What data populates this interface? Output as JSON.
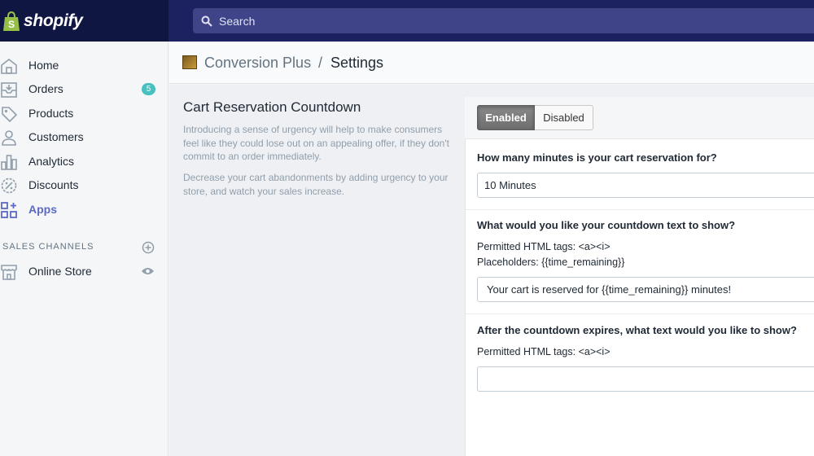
{
  "brand": {
    "name": "shopify"
  },
  "search": {
    "placeholder": "Search"
  },
  "sidebar": {
    "items": [
      {
        "label": "Home",
        "icon": "home-icon"
      },
      {
        "label": "Orders",
        "icon": "orders-icon",
        "badge": "5"
      },
      {
        "label": "Products",
        "icon": "tag-icon"
      },
      {
        "label": "Customers",
        "icon": "person-icon"
      },
      {
        "label": "Analytics",
        "icon": "bar-chart-icon"
      },
      {
        "label": "Discounts",
        "icon": "discount-icon"
      },
      {
        "label": "Apps",
        "icon": "apps-icon",
        "active": true
      }
    ],
    "section_heading": "SALES CHANNELS",
    "channels": [
      {
        "label": "Online Store",
        "icon": "store-icon"
      }
    ]
  },
  "header": {
    "app_name": "Conversion Plus",
    "separator": "/",
    "page": "Settings"
  },
  "section": {
    "title": "Cart Reservation Countdown",
    "paragraph1": "Introducing a sense of urgency will help to make consumers feel like they could lose out on an appealing offer, if they don't commit to an order immediately.",
    "paragraph2": "Decrease your cart abandonments by adding urgency to your store, and watch your sales increase."
  },
  "toggle": {
    "enabled_label": "Enabled",
    "disabled_label": "Disabled",
    "selected": "Enabled"
  },
  "form": {
    "q1": {
      "label": "How many minutes is your cart reservation for?",
      "value": "10 Minutes"
    },
    "q2": {
      "label": "What would you like your countdown text to show?",
      "permitted": "Permitted HTML tags: <a><i>",
      "placeholders": "Placeholders: {{time_remaining}}",
      "value": "Your cart is reserved for {{time_remaining}} minutes!"
    },
    "q3": {
      "label": "After the countdown expires, what text would you like to show?",
      "permitted": "Permitted HTML tags: <a><i>",
      "value": ""
    }
  },
  "colors": {
    "topbar": "#1c2260",
    "logo_bg": "#0f1642",
    "accent": "#5c6ac4",
    "badge": "#47c1bf"
  }
}
